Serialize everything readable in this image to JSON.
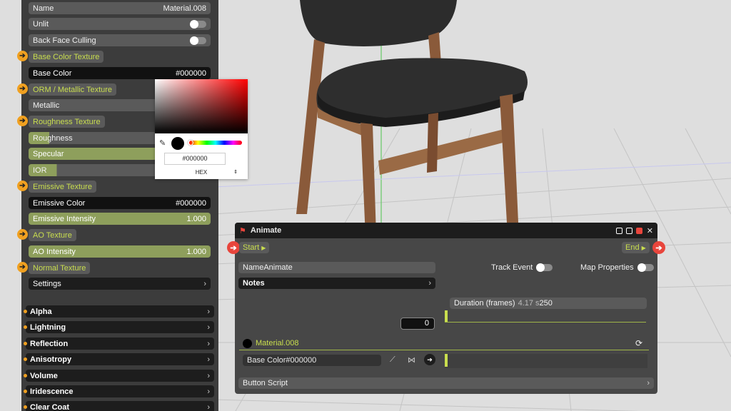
{
  "material_panel": {
    "name_label": "Name",
    "name_value": "Material.008",
    "unlit_label": "Unlit",
    "back_face_label": "Back Face Culling",
    "base_color_texture": "Base Color Texture",
    "base_color_label": "Base Color",
    "base_color_value": "#000000",
    "orm_texture": "ORM / Metallic Texture",
    "metallic_label": "Metallic",
    "roughness_texture": "Roughness Texture",
    "roughness_label": "Roughness",
    "specular_label": "Specular",
    "ior_label": "IOR",
    "emissive_texture": "Emissive Texture",
    "emissive_color_label": "Emissive Color",
    "emissive_color_value": "#000000",
    "emissive_intensity_label": "Emissive Intensity",
    "emissive_intensity_value": "1.000",
    "ao_texture": "AO Texture",
    "ao_intensity_label": "AO Intensity",
    "ao_intensity_value": "1.000",
    "normal_texture": "Normal Texture",
    "settings_label": "Settings",
    "sections": [
      "Alpha",
      "Lightning",
      "Reflection",
      "Anisotropy",
      "Volume",
      "Iridescence",
      "Clear Coat"
    ]
  },
  "color_picker": {
    "hex_value": "#000000",
    "mode": "HEX",
    "selected_color": "#000000"
  },
  "animate": {
    "title": "Animate",
    "start_label": "Start",
    "end_label": "End",
    "name_label": "Name",
    "name_value": "Animate",
    "track_event_label": "Track Event",
    "map_properties_label": "Map Properties",
    "notes_label": "Notes",
    "duration_label": "Duration (frames)",
    "duration_seconds": "4.17 s",
    "duration_value": "250",
    "current_frame": "0",
    "track_material": "Material.008",
    "track_property_label": "Base Color",
    "track_property_value": "#000000",
    "button_script_label": "Button Script"
  },
  "colors": {
    "accent_green": "#c9de4e",
    "accent_orange": "#f0a020",
    "accent_red": "#e8453c",
    "panel_bg": "#3c3c3c"
  }
}
